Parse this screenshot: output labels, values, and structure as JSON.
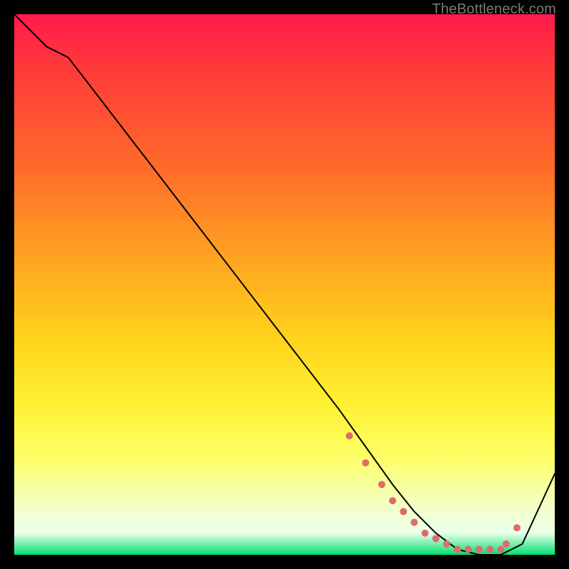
{
  "watermark": "TheBottleneck.com",
  "chart_data": {
    "type": "line",
    "title": "",
    "xlabel": "",
    "ylabel": "",
    "xlim": [
      0,
      100
    ],
    "ylim": [
      0,
      100
    ],
    "grid": false,
    "series": [
      {
        "name": "curve",
        "color": "#000000",
        "x": [
          0,
          6,
          10,
          20,
          30,
          40,
          50,
          60,
          65,
          70,
          74,
          78,
          82,
          86,
          90,
          94,
          100
        ],
        "y": [
          100,
          94,
          92,
          79,
          66,
          53,
          40,
          27,
          20,
          13,
          8,
          4,
          1,
          0,
          0,
          2,
          15
        ]
      }
    ],
    "markers": {
      "name": "dots",
      "color": "#e06a6a",
      "radius": 5,
      "x": [
        62,
        65,
        68,
        70,
        72,
        74,
        76,
        78,
        80,
        82,
        84,
        86,
        88,
        90,
        91,
        93
      ],
      "y": [
        22,
        17,
        13,
        10,
        8,
        6,
        4,
        3,
        2,
        1,
        1,
        1,
        1,
        1,
        2,
        5
      ]
    }
  }
}
